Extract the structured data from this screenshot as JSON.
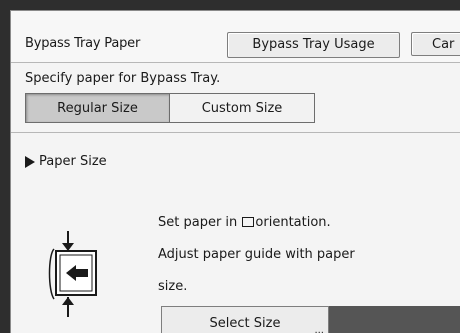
{
  "header": {
    "title": "Bypass Tray Paper",
    "usage_button": "Bypass Tray Usage",
    "cancel_button": "Car"
  },
  "instruction": "Specify paper for Bypass Tray.",
  "tabs": [
    {
      "label": "Regular Size",
      "selected": true
    },
    {
      "label": "Custom Size",
      "selected": false
    }
  ],
  "section": {
    "label": "Paper Size"
  },
  "message": {
    "line1_before": "Set paper in ",
    "line1_after": "orientation.",
    "line2": "Adjust paper guide with paper",
    "line3": "size."
  },
  "select_size": {
    "label": "Select Size",
    "ellipsis": "..."
  },
  "icons": {
    "section": "triangle-right-icon",
    "orientation": "paper-orientation-icon",
    "paper_guide": "paper-guide-icon"
  }
}
